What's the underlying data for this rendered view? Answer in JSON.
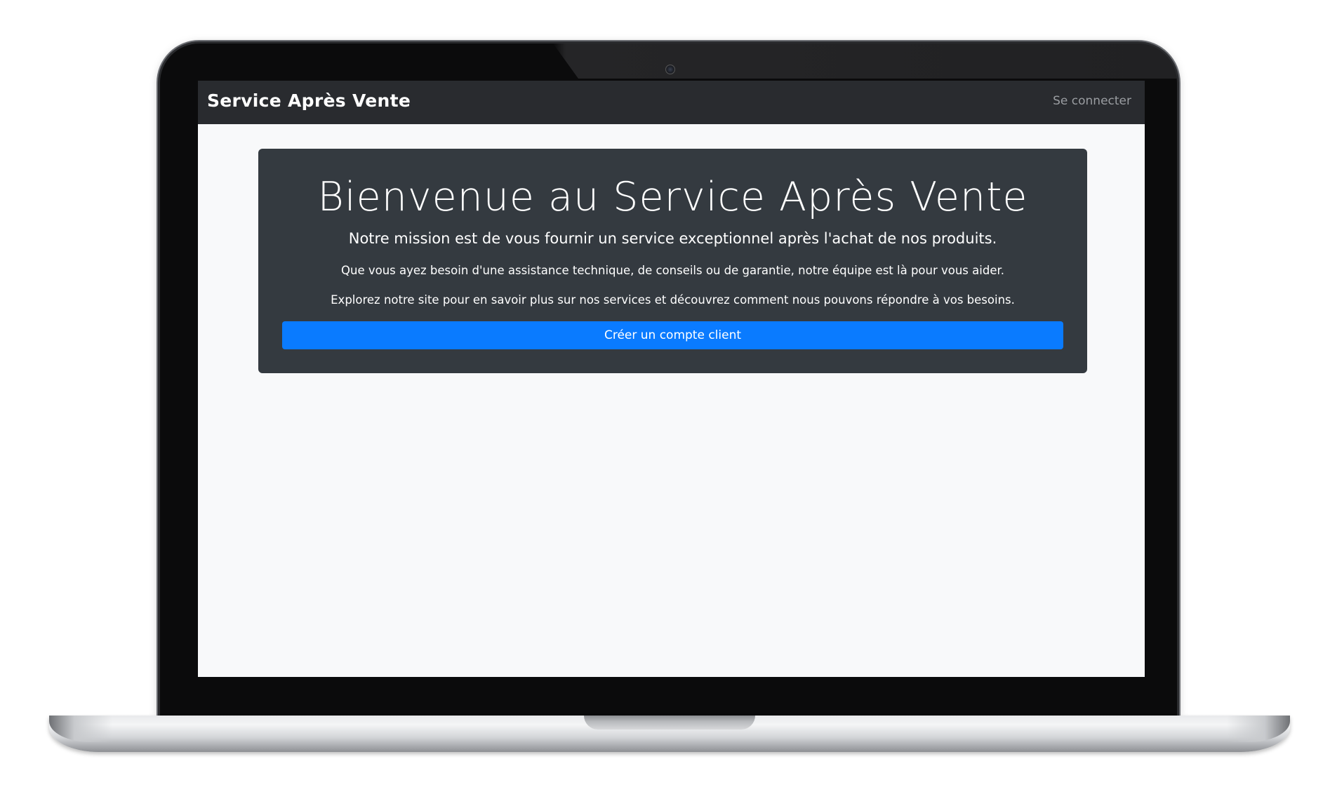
{
  "navbar": {
    "brand": "Service Après Vente",
    "login_label": "Se connecter"
  },
  "hero": {
    "title": "Bienvenue au Service Après Vente",
    "lead": "Notre mission est de vous fournir un service exceptionnel après l'achat de nos produits.",
    "paragraph_1": "Que vous ayez besoin d'une assistance technique, de conseils ou de garantie, notre équipe est là pour vous aider.",
    "paragraph_2": "Explorez notre site pour en savoir plus sur nos services et découvrez comment nous pouvons répondre à vos besoins.",
    "cta_label": "Créer un compte client"
  },
  "colors": {
    "navbar_bg": "#292b2f",
    "hero_bg": "#343a40",
    "primary": "#0a7bff",
    "page_bg": "#f8f9fa"
  }
}
